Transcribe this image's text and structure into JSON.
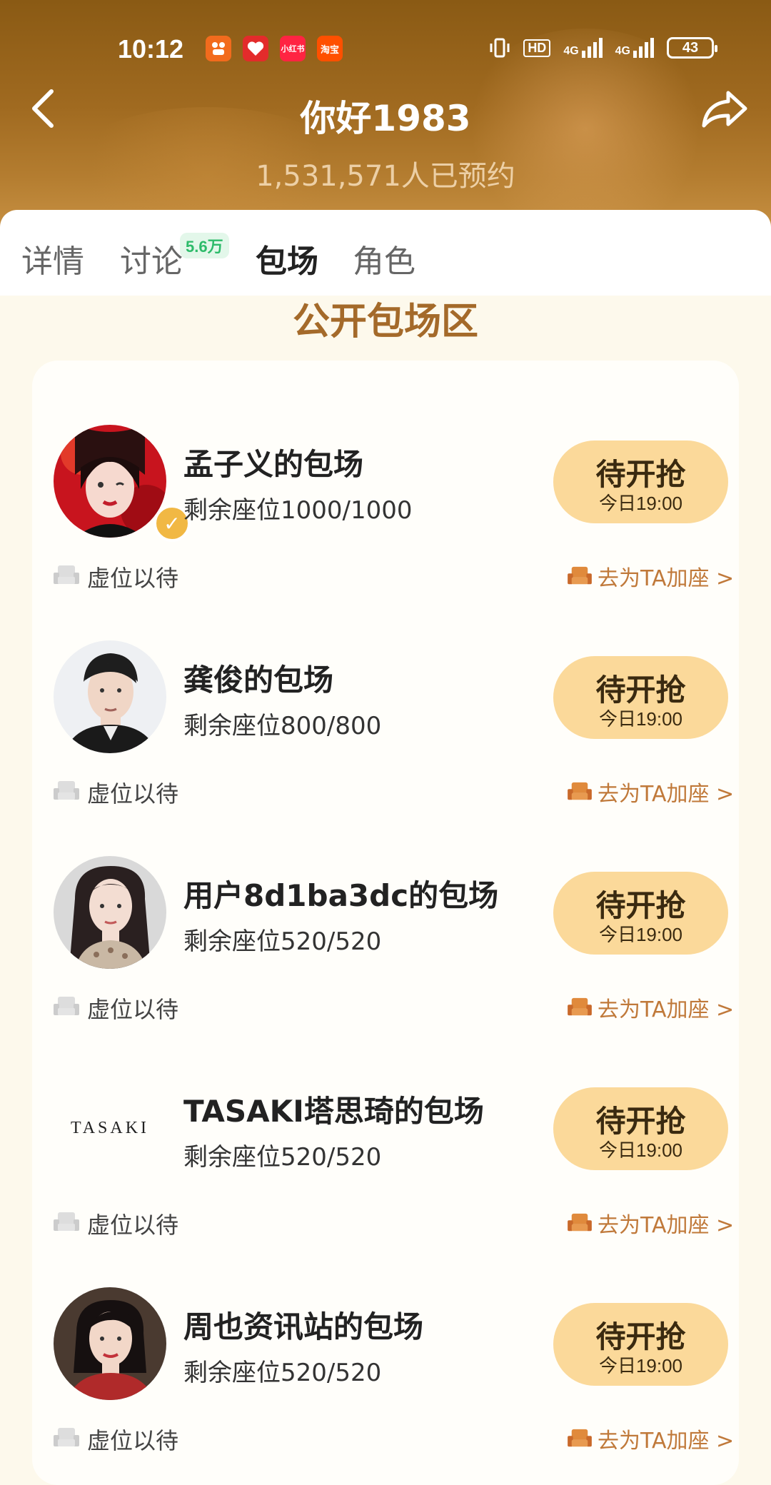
{
  "status_bar": {
    "time": "10:12",
    "network1": "4G",
    "network2": "4G",
    "hd_label": "HD",
    "battery": "43",
    "apps": [
      "app-orange",
      "app-red-heart",
      "小红书",
      "淘宝"
    ]
  },
  "header": {
    "title": "你好1983",
    "subtitle": "1,531,571人已预约"
  },
  "tabs": [
    {
      "label": "详情"
    },
    {
      "label": "讨论",
      "badge": "5.6万"
    },
    {
      "label": "包场"
    },
    {
      "label": "角色"
    }
  ],
  "section_title": "公开包场区",
  "rows": [
    {
      "name": "孟子义的包场",
      "seats": "剩余座位1000/1000",
      "button": "待开抢",
      "time": "今日19:00",
      "wait": "虚位以待",
      "add": "去为TA加座 >",
      "avatar": "avatar-woman-red",
      "verified": true
    },
    {
      "name": "龚俊的包场",
      "seats": "剩余座位800/800",
      "button": "待开抢",
      "time": "今日19:00",
      "wait": "虚位以待",
      "add": "去为TA加座 >",
      "avatar": "avatar-man-suit",
      "verified": false
    },
    {
      "name": "用户8d1ba3dc的包场",
      "seats": "剩余座位520/520",
      "button": "待开抢",
      "time": "今日19:00",
      "wait": "虚位以待",
      "add": "去为TA加座 >",
      "avatar": "avatar-woman-longhair",
      "verified": false
    },
    {
      "name": "TASAKI塔思琦的包场",
      "seats": "剩余座位520/520",
      "button": "待开抢",
      "time": "今日19:00",
      "wait": "虚位以待",
      "add": "去为TA加座 >",
      "avatar": "TASAKI",
      "verified": false
    },
    {
      "name": "周也资讯站的包场",
      "seats": "剩余座位520/520",
      "button": "待开抢",
      "time": "今日19:00",
      "wait": "虚位以待",
      "add": "去为TA加座 >",
      "avatar": "avatar-woman-shorthair",
      "verified": false
    }
  ],
  "colors": {
    "header": "#a06a20",
    "section_title": "#a46a2a",
    "button": "#fbd99a",
    "add_link": "#c0793a",
    "badge_bg": "#e3f7ea",
    "badge_text": "#2dbb6a"
  }
}
